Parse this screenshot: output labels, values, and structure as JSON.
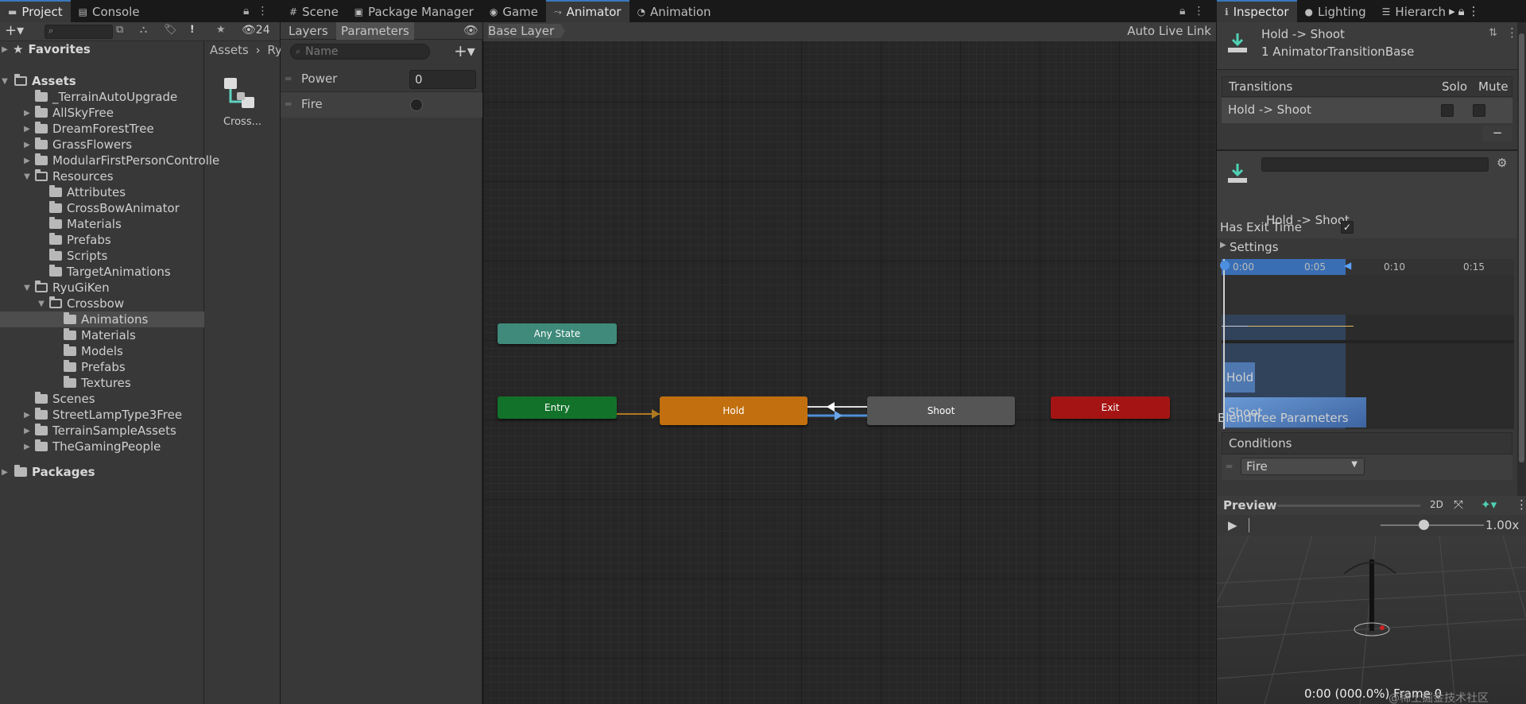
{
  "left_tabs": [
    {
      "label": "Project",
      "icon": "folder-icon"
    },
    {
      "label": "Console",
      "icon": "console-icon"
    }
  ],
  "center_tabs": [
    {
      "label": "Scene",
      "icon": "scene-icon"
    },
    {
      "label": "Package Manager",
      "icon": "package-icon"
    },
    {
      "label": "Game",
      "icon": "game-icon"
    },
    {
      "label": "Animator",
      "icon": "animator-icon"
    },
    {
      "label": "Animation",
      "icon": "animation-icon"
    }
  ],
  "right_tabs": [
    {
      "label": "Inspector",
      "icon": "info-icon"
    },
    {
      "label": "Lighting",
      "icon": "bulb-icon"
    },
    {
      "label": "Hierarch",
      "icon": "hierarchy-icon"
    }
  ],
  "project": {
    "hidden_count": "24",
    "favorites": "Favorites",
    "assets_root": "Assets",
    "packages": "Packages",
    "breadcrumb": [
      "Assets",
      "Ry"
    ],
    "asset_item": "Cross...",
    "tree": [
      {
        "label": "_TerrainAutoUpgrade",
        "depth": 1,
        "arrow": ""
      },
      {
        "label": "AllSkyFree",
        "depth": 1,
        "arrow": "▶"
      },
      {
        "label": "DreamForestTree",
        "depth": 1,
        "arrow": "▶"
      },
      {
        "label": "GrassFlowers",
        "depth": 1,
        "arrow": "▶"
      },
      {
        "label": "ModularFirstPersonControlle",
        "depth": 1,
        "arrow": "▶"
      },
      {
        "label": "Resources",
        "depth": 1,
        "arrow": "▼",
        "open": true
      },
      {
        "label": "Attributes",
        "depth": 2,
        "arrow": ""
      },
      {
        "label": "CrossBowAnimator",
        "depth": 2,
        "arrow": ""
      },
      {
        "label": "Materials",
        "depth": 2,
        "arrow": ""
      },
      {
        "label": "Prefabs",
        "depth": 2,
        "arrow": ""
      },
      {
        "label": "Scripts",
        "depth": 2,
        "arrow": ""
      },
      {
        "label": "TargetAnimations",
        "depth": 2,
        "arrow": ""
      },
      {
        "label": "RyuGiKen",
        "depth": 1,
        "arrow": "▼",
        "open": true
      },
      {
        "label": "Crossbow",
        "depth": 2,
        "arrow": "▼",
        "open": true
      },
      {
        "label": "Animations",
        "depth": 3,
        "arrow": "",
        "selected": true
      },
      {
        "label": "Materials",
        "depth": 3,
        "arrow": ""
      },
      {
        "label": "Models",
        "depth": 3,
        "arrow": ""
      },
      {
        "label": "Prefabs",
        "depth": 3,
        "arrow": ""
      },
      {
        "label": "Textures",
        "depth": 3,
        "arrow": ""
      },
      {
        "label": "Scenes",
        "depth": 1,
        "arrow": ""
      },
      {
        "label": "StreetLampType3Free",
        "depth": 1,
        "arrow": "▶"
      },
      {
        "label": "TerrainSampleAssets",
        "depth": 1,
        "arrow": "▶"
      },
      {
        "label": "TheGamingPeople",
        "depth": 1,
        "arrow": "▶"
      }
    ]
  },
  "animator": {
    "layers_tab": "Layers",
    "parameters_tab": "Parameters",
    "search_placeholder": "Name",
    "base_layer": "Base Layer",
    "auto_live_link": "Auto Live Link",
    "params": [
      {
        "name": "Power",
        "value": "0",
        "type": "float"
      },
      {
        "name": "Fire",
        "type": "trigger"
      }
    ],
    "nodes": {
      "any": "Any State",
      "entry": "Entry",
      "hold": "Hold",
      "shoot": "Shoot",
      "exit": "Exit"
    },
    "colors": {
      "any": "#3f8a7a",
      "entry": "#12722a",
      "hold": "#c2700f",
      "shoot": "#555555",
      "exit": "#a51414"
    }
  },
  "inspector": {
    "title": "Hold -> Shoot",
    "subtitle": "1 AnimatorTransitionBase",
    "transitions_header": "Transitions",
    "solo": "Solo",
    "mute": "Mute",
    "transition_row": "Hold -> Shoot",
    "minus": "−",
    "detail_name": "Hold -> Shoot",
    "has_exit_time": "Has Exit Time",
    "settings": "Settings",
    "timeline_ticks": [
      "0:00",
      "0:05",
      "0:10",
      "0:15"
    ],
    "bar_hold": "Hold",
    "bar_shoot": "Shoot",
    "blendtree": "BlendTree Parameters",
    "conditions": "Conditions",
    "condition_value": "Fire",
    "preview": "Preview",
    "preview_2d": "2D",
    "speed": "1.00x",
    "frame_info": "0:00 (000.0%) Frame 0",
    "watermark": "@稀土掘金技术社区"
  }
}
